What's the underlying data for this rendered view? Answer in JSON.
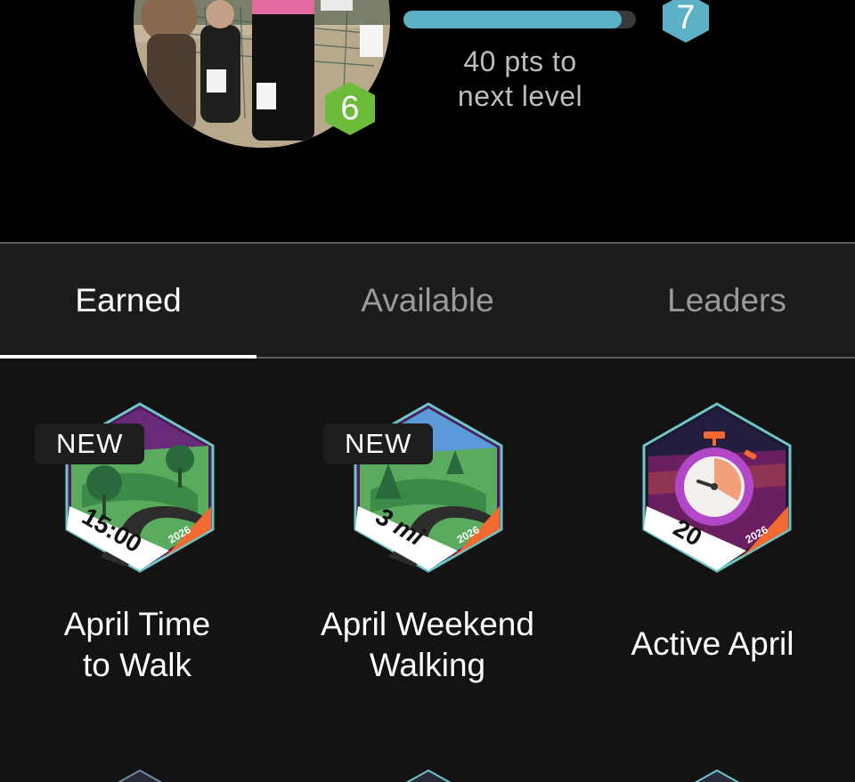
{
  "profile": {
    "avatar": "profile-photo",
    "current_level": "6",
    "next_level": "7",
    "progress": 0.94,
    "pts_line1": "40 pts to",
    "pts_line2": "next level",
    "colors": {
      "level_badge": "#6dbb3a",
      "next_badge": "#5cb1c6",
      "progress": "#5cb1c6"
    }
  },
  "tabs": [
    {
      "label": "Earned",
      "active": true
    },
    {
      "label": "Available",
      "active": false
    },
    {
      "label": "Leaders",
      "active": false
    }
  ],
  "badges": [
    {
      "title_line1": "April Time",
      "title_line2": "to Walk",
      "tag": "NEW",
      "ribbon_text": "15:00",
      "year": "2026",
      "icon": "walking-path-icon"
    },
    {
      "title_line1": "April Weekend",
      "title_line2": "Walking",
      "tag": "NEW",
      "ribbon_text": "3 mi",
      "year": "2026",
      "icon": "walking-path-icon"
    },
    {
      "title_line1": "Active April",
      "title_line2": "",
      "tag": "",
      "ribbon_text": "20",
      "year": "2026",
      "icon": "stopwatch-icon"
    }
  ]
}
